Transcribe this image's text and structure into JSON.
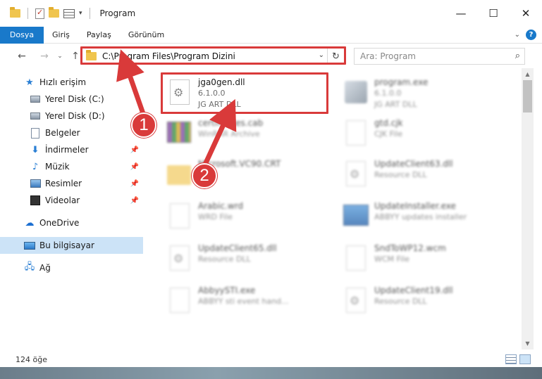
{
  "window": {
    "title": "Program",
    "controls": {
      "minimize": "—",
      "maximize": "☐",
      "close": "✕"
    }
  },
  "ribbon": {
    "tabs": [
      {
        "label": "Dosya",
        "active": true
      },
      {
        "label": "Giriş"
      },
      {
        "label": "Paylaş"
      },
      {
        "label": "Görünüm"
      }
    ],
    "help": "?"
  },
  "address": {
    "path": "C:\\Program Files\\Program Dizini",
    "search_placeholder": "Ara: Program"
  },
  "nav": {
    "items": [
      {
        "label": "Hızlı erişim",
        "icon": "star-icon"
      },
      {
        "label": "Yerel Disk (C:)",
        "icon": "disk-icon"
      },
      {
        "label": "Yerel Disk (D:)",
        "icon": "disk-icon"
      },
      {
        "label": "Belgeler",
        "icon": "documents-icon"
      },
      {
        "label": "İndirmeler",
        "icon": "downloads-icon",
        "pinned": true
      },
      {
        "label": "Müzik",
        "icon": "music-icon",
        "pinned": true
      },
      {
        "label": "Resimler",
        "icon": "pictures-icon",
        "pinned": true
      },
      {
        "label": "Videolar",
        "icon": "videos-icon",
        "pinned": true
      },
      {
        "label": "OneDrive",
        "icon": "onedrive-icon"
      },
      {
        "label": "Bu bilgisayar",
        "icon": "this-pc-icon",
        "selected": true
      },
      {
        "label": "Ağ",
        "icon": "network-icon"
      }
    ]
  },
  "files": [
    {
      "name": "jga0gen.dll",
      "line2": "6.1.0.0",
      "line3": "JG ART DLL",
      "highlighted": true
    },
    {
      "name": "program.exe",
      "line2": "6.1.0.0",
      "line3": "JG ART DLL"
    },
    {
      "name": "certificates.cab",
      "line2": "WinRAR Archive",
      "line3": ""
    },
    {
      "name": "gtd.cjk",
      "line2": "CJK File",
      "line3": ""
    },
    {
      "name": "Microsoft.VC90.CRT",
      "line2": "",
      "line3": ""
    },
    {
      "name": "UpdateClient63.dll",
      "line2": "Resource DLL",
      "line3": ""
    },
    {
      "name": "Arabic.wrd",
      "line2": "WRD File",
      "line3": ""
    },
    {
      "name": "UpdateInstaller.exe",
      "line2": "ABBYY updates installer",
      "line3": ""
    },
    {
      "name": "UpdateClient65.dll",
      "line2": "Resource DLL",
      "line3": ""
    },
    {
      "name": "SndToWP12.wcm",
      "line2": "WCM File",
      "line3": ""
    },
    {
      "name": "AbbyySTI.exe",
      "line2": "ABBYY sti event hand...",
      "line3": ""
    },
    {
      "name": "UpdateClient19.dll",
      "line2": "Resource DLL",
      "line3": ""
    }
  ],
  "callouts": {
    "one": "1",
    "two": "2"
  },
  "status": {
    "count": "124 öğe"
  }
}
